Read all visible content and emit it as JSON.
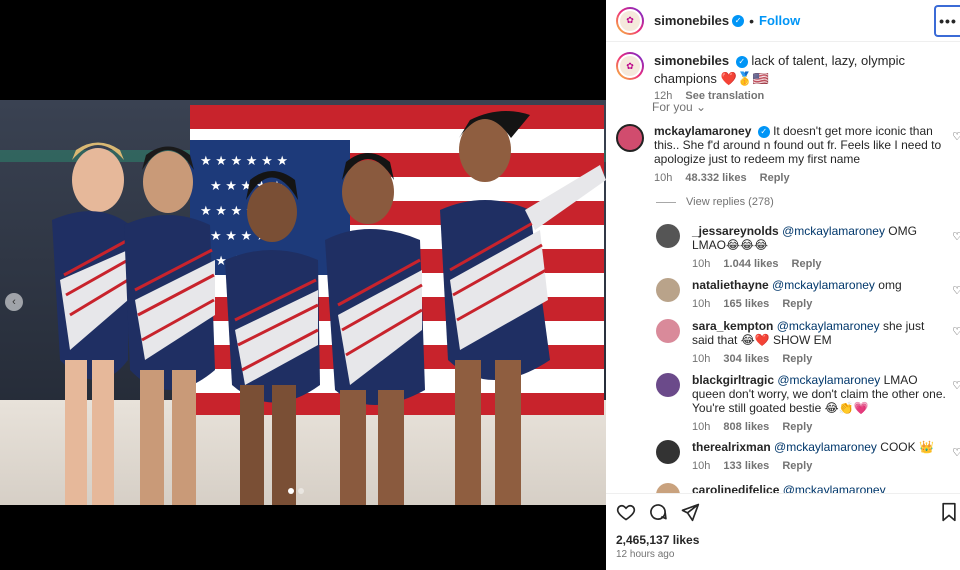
{
  "post": {
    "username": "simonebiles",
    "follow_label": "Follow",
    "more_label": "•••",
    "dot_separator": "•"
  },
  "caption": {
    "username": "simonebiles",
    "text": "lack of talent, lazy, olympic champions ❤️🥇🇺🇸",
    "time": "12h",
    "translate": "See translation"
  },
  "for_you": "For you",
  "comments": [
    {
      "username": "mckaylamaroney",
      "verified": true,
      "mention": "",
      "text": "It doesn't get more iconic than this.. She f'd around n found out fr. Feels like I need to apologize just to redeem my first name",
      "time": "10h",
      "likes": "48.332 likes",
      "reply": "Reply"
    },
    {
      "username": "_jessareynolds",
      "mention": "@mckaylamaroney",
      "text": "OMG LMAO😂😂😂",
      "time": "10h",
      "likes": "1.044 likes",
      "reply": "Reply"
    },
    {
      "username": "nataliethayne",
      "mention": "@mckaylamaroney",
      "text": "omg",
      "time": "10h",
      "likes": "165 likes",
      "reply": "Reply"
    },
    {
      "username": "sara_kempton",
      "mention": "@mckaylamaroney",
      "text": "she just said that 😂❤️ SHOW EM",
      "time": "10h",
      "likes": "304 likes",
      "reply": "Reply"
    },
    {
      "username": "blackgirltragic",
      "mention": "@mckaylamaroney",
      "text": "LMAO queen don't worry, we don't claim the other one. You're still goated bestie 😂👏💗",
      "time": "10h",
      "likes": "808 likes",
      "reply": "Reply"
    },
    {
      "username": "therealrixman",
      "mention": "@mckaylamaroney",
      "text": "COOK 👑",
      "time": "10h",
      "likes": "133 likes",
      "reply": "Reply"
    },
    {
      "username": "carolinedifelice",
      "mention": "@mckaylamaroney @aimeebalecc",
      "text": "",
      "time": "",
      "likes": "",
      "reply": ""
    }
  ],
  "view_replies": "View replies (278)",
  "likes_count": "2,465,137 likes",
  "posted_ago": "12 hours ago",
  "colors": {
    "accent": "#0095f6",
    "text": "#262626",
    "muted": "#737373"
  },
  "icons": [
    "heart-icon",
    "comment-icon",
    "share-icon",
    "bookmark-icon",
    "chevron-left-icon",
    "chevron-down-icon",
    "verified-icon"
  ]
}
